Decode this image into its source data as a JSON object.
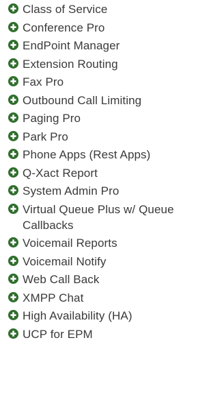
{
  "accent_color": "#2f6e2c",
  "text_color": "#3a3a3a",
  "icon": "plus-circle-icon",
  "items": [
    {
      "label": "Class of Service"
    },
    {
      "label": "Conference Pro"
    },
    {
      "label": "EndPoint Manager"
    },
    {
      "label": "Extension Routing"
    },
    {
      "label": "Fax Pro"
    },
    {
      "label": "Outbound Call Limiting"
    },
    {
      "label": "Paging Pro"
    },
    {
      "label": "Park Pro"
    },
    {
      "label": "Phone Apps (Rest Apps)"
    },
    {
      "label": "Q-Xact Report"
    },
    {
      "label": "System Admin Pro"
    },
    {
      "label": "Virtual Queue Plus w/ Queue Callbacks"
    },
    {
      "label": "Voicemail Reports"
    },
    {
      "label": "Voicemail Notify"
    },
    {
      "label": "Web Call Back"
    },
    {
      "label": "XMPP Chat"
    },
    {
      "label": "High Availability (HA)"
    },
    {
      "label": "UCP for EPM"
    }
  ]
}
